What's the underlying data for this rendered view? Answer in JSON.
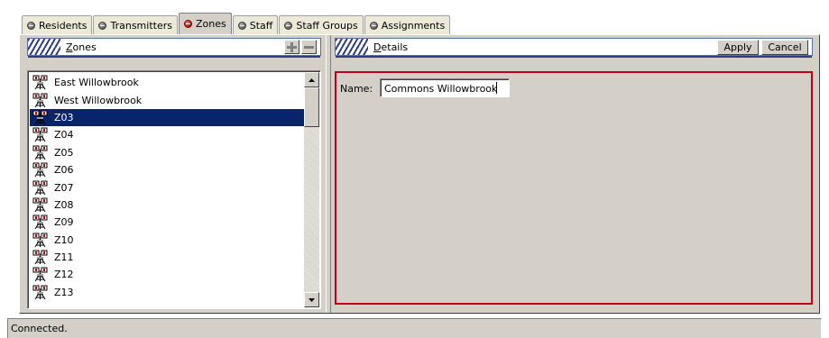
{
  "tabs": [
    {
      "label": "Residents",
      "active": false
    },
    {
      "label": "Transmitters",
      "active": false
    },
    {
      "label": "Zones",
      "active": true
    },
    {
      "label": "Staff",
      "active": false
    },
    {
      "label": "Staff Groups",
      "active": false
    },
    {
      "label": "Assignments",
      "active": false
    }
  ],
  "zones_panel": {
    "title_first": "Z",
    "title_rest": "ones",
    "add_icon": "plus-icon",
    "remove_icon": "minus-icon"
  },
  "zones_list": {
    "selected": "Z03",
    "items": [
      "East Willowbrook",
      "West Willowbrook",
      "Z03",
      "Z04",
      "Z05",
      "Z06",
      "Z07",
      "Z08",
      "Z09",
      "Z10",
      "Z11",
      "Z12",
      "Z13"
    ],
    "item_icon": "tower-icon"
  },
  "details_panel": {
    "title_first": "D",
    "title_rest": "etails",
    "apply_label": "Apply",
    "cancel_label": "Cancel",
    "name_label": "Name:",
    "name_value": "Commons Willowbrook"
  },
  "status": {
    "text": "Connected."
  },
  "colors": {
    "selection": "#0a246a",
    "details_border": "#c0001a",
    "header_stripe": "#2b3f8c",
    "active_tab_dot": "#c00000"
  }
}
